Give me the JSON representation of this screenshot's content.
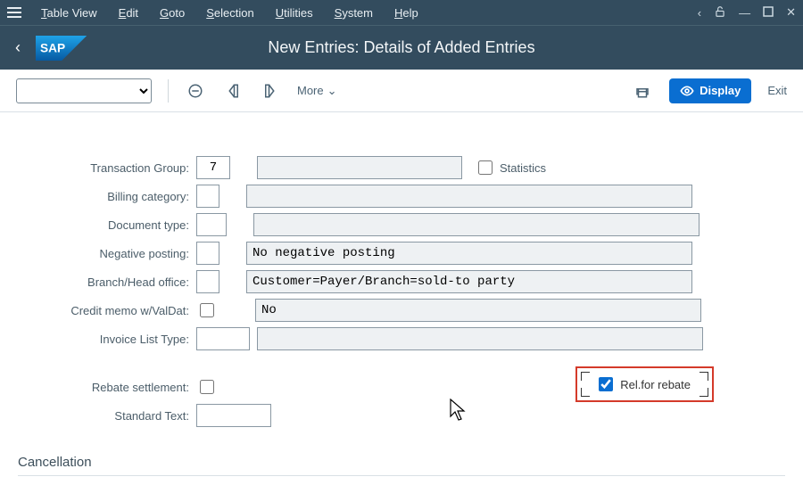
{
  "menu": {
    "items": [
      "Table View",
      "Edit",
      "Goto",
      "Selection",
      "Utilities",
      "System",
      "Help"
    ]
  },
  "header": {
    "title": "New Entries: Details of Added Entries"
  },
  "toolbar": {
    "more": "More",
    "display": "Display",
    "exit": "Exit"
  },
  "form": {
    "transaction_group": {
      "label": "Transaction Group:",
      "value": "7"
    },
    "statistics_chk": {
      "label": "Statistics",
      "checked": false
    },
    "billing_category": {
      "label": "Billing category:",
      "value": ""
    },
    "document_type": {
      "label": "Document type:",
      "value": ""
    },
    "negative_posting": {
      "label": "Negative posting:",
      "value": "No negative posting"
    },
    "branch_head": {
      "label": "Branch/Head office:",
      "value": "Customer=Payer/Branch=sold-to party"
    },
    "credit_memo": {
      "label": "Credit memo w/ValDat:",
      "checked": false,
      "value": "No"
    },
    "invoice_list_type": {
      "label": "Invoice List Type:",
      "value": ""
    },
    "rebate_settlement": {
      "label": "Rebate settlement:",
      "checked": false
    },
    "rel_for_rebate": {
      "label": "Rel.for rebate",
      "checked": true
    },
    "standard_text": {
      "label": "Standard Text:",
      "value": ""
    }
  },
  "sections": {
    "cancellation": "Cancellation"
  }
}
